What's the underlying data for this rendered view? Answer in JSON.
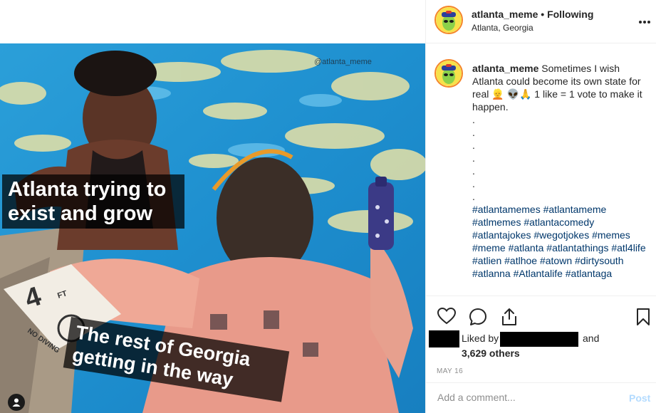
{
  "media": {
    "watermark": "@atlanta_meme",
    "caption_top": "Atlanta trying to exist and grow",
    "caption_bottom": "The rest of Georgia getting in the way",
    "pool_marker": "4",
    "pool_marker_sub": "FT",
    "pool_sign": "NO DIVING"
  },
  "header": {
    "username": "atlanta_meme",
    "separator": "•",
    "follow_label": "Following",
    "location": "Atlanta, Georgia",
    "more_icon": "more-options-icon"
  },
  "post": {
    "username": "atlanta_meme",
    "caption": "Sometimes I wish Atlanta could become its own state for real 👱 👽🙏 1 like = 1 vote to make it happen.",
    "dots": [
      ".",
      ".",
      ".",
      ".",
      ".",
      ".",
      "."
    ],
    "hashtags": "#atlantamemes #atlantameme #atlmemes #atlantacomedy #atlantajokes #wegotjokes #memes #meme #atlanta #atlantathings #atl4life #atlien #atlhoe #atown #dirtysouth #atlanna #Atlantalife #atlantaga"
  },
  "actions": {
    "like_icon": "heart-icon",
    "comment_icon": "comment-bubble-icon",
    "share_icon": "share-icon",
    "save_icon": "bookmark-icon",
    "liked_by": "Liked by",
    "and": "and",
    "others": "3,629 others",
    "date": "MAY 16"
  },
  "comment_box": {
    "placeholder": "Add a comment...",
    "post_label": "Post"
  },
  "colors": {
    "accent_link": "#00376b",
    "post_disabled": "#b3dbff",
    "muted": "#8e8e8e",
    "divider": "#efefef"
  }
}
